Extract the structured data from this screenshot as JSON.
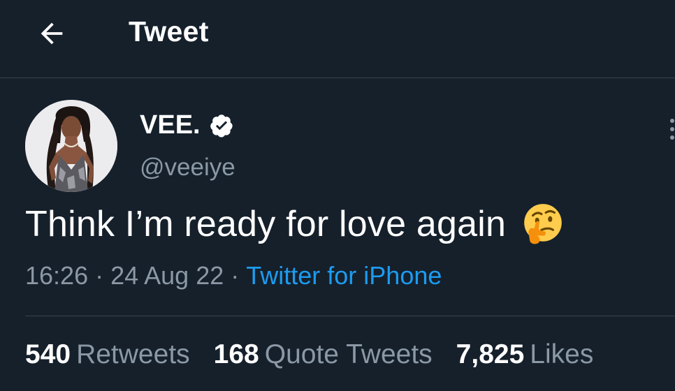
{
  "header": {
    "back_icon": "arrow-left-icon",
    "title": "Tweet"
  },
  "author": {
    "name": "VEE.",
    "verified_icon": "verified-badge-icon",
    "handle": "@veeiye",
    "avatar": "profile-photo"
  },
  "tweet": {
    "text": "Think I’m ready for love again",
    "emoji": "thinking-face-emoji",
    "time": "16:26",
    "date": "24 Aug 22",
    "separator": "·",
    "source": "Twitter for iPhone"
  },
  "stats": [
    {
      "count": "540",
      "label": "Retweets"
    },
    {
      "count": "168",
      "label": "Quote Tweets"
    },
    {
      "count": "7,825",
      "label": "Likes"
    }
  ],
  "colors": {
    "background": "#15202b",
    "text": "#ffffff",
    "secondary": "#8b98a5",
    "link": "#1d9bf0",
    "divider": "#38444d"
  }
}
